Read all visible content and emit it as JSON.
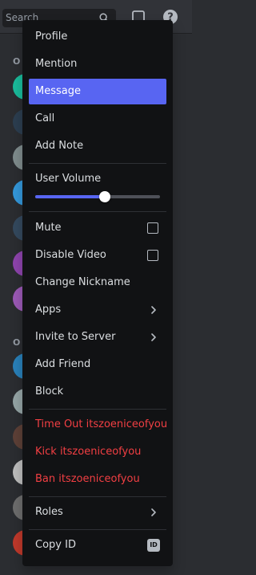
{
  "search": {
    "placeholder": "Search"
  },
  "member_list": {
    "group_letters": [
      "O",
      "O"
    ],
    "avatar_colors": [
      "#1abc9c",
      "#2c3e50",
      "#7f8c8d",
      "#3498db",
      "#34495e",
      "#8e44ad",
      "#9b59b6",
      "#2980b9",
      "#95a5a6",
      "#5d4037",
      "#bdbdbd",
      "#6d6d6d",
      "#c0392b"
    ]
  },
  "menu": {
    "profile": "Profile",
    "mention": "Mention",
    "message": "Message",
    "call": "Call",
    "add_note": "Add Note",
    "user_volume": "User Volume",
    "user_volume_level": 0.56,
    "mute": "Mute",
    "disable_video": "Disable Video",
    "change_nickname": "Change Nickname",
    "apps": "Apps",
    "invite_to_server": "Invite to Server",
    "add_friend": "Add Friend",
    "block": "Block",
    "time_out": "Time Out itszoeniceofyou",
    "kick": "Kick itszoeniceofyou",
    "ban": "Ban itszoeniceofyou",
    "roles": "Roles",
    "copy_id": "Copy ID",
    "id_badge": "ID"
  },
  "colors": {
    "accent": "#5865f2",
    "danger": "#f23f43",
    "menu_bg": "#111214"
  }
}
